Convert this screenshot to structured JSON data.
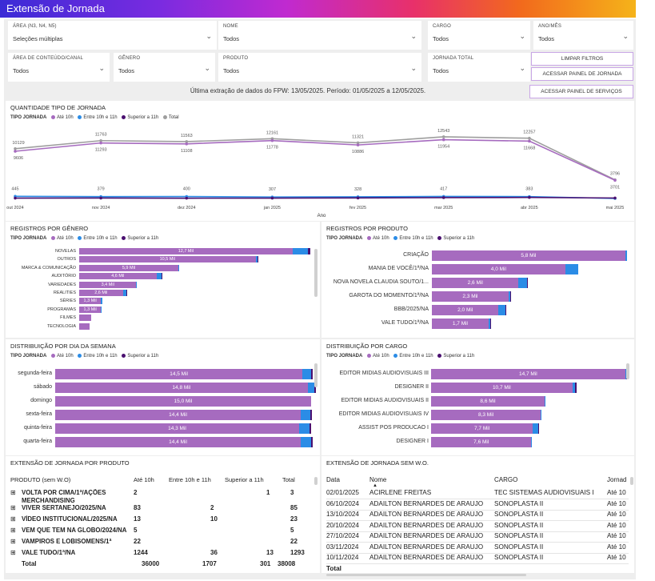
{
  "title": "Extensão de Jornada",
  "filters": [
    {
      "label": "ÁREA (N3, N4, N5)",
      "value": "Seleções múltiplas"
    },
    {
      "label": "NOME",
      "value": "Todos"
    },
    {
      "label": "CARGO",
      "value": "Todos"
    },
    {
      "label": "ANO/MÊS",
      "value": "Todos"
    },
    {
      "label": "ÁREA DE CONTEÚDO/CANAL",
      "value": "Todos"
    },
    {
      "label": "GÊNERO",
      "value": "Todos"
    },
    {
      "label": "PRODUTO",
      "value": "Todos"
    },
    {
      "label": "JORNADA TOTAL",
      "value": "Todos"
    }
  ],
  "buttons": {
    "limpar": "LIMPAR FILTROS",
    "painel_jornada": "ACESSAR PAINEL DE JORNADA",
    "painel_servicos": "ACESSAR PAINEL DE SERVIÇOS"
  },
  "extraction_text": "Última extração de dados do FPW: 13/05/2025. Período: 01/05/2025 a 12/05/2025.",
  "legend_title": "TIPO JORNADA",
  "legend_items": [
    {
      "name": "Até 10h",
      "color": "#a66bbf"
    },
    {
      "name": "Entre 10h e 11h",
      "color": "#2b8ce6"
    },
    {
      "name": "Superior a 11h",
      "color": "#4a1070"
    },
    {
      "name": "Total",
      "color": "#9e9e9e"
    }
  ],
  "chart_data": [
    {
      "type": "line",
      "title": "QUANTIDADE TIPO DE JORNADA",
      "xlabel": "Ano",
      "categories": [
        "out 2024",
        "nov 2024",
        "dez 2024",
        "jan 2025",
        "fev 2025",
        "mar 2025",
        "abr 2025",
        "mai 2025"
      ],
      "series": [
        {
          "name": "Total",
          "values": [
            10129,
            11763,
            11563,
            12161,
            11321,
            12543,
            12257,
            3796
          ],
          "labels": [
            "10129",
            "11763",
            "11563",
            "12161",
            "11321",
            "12543",
            "12257",
            "3796"
          ]
        },
        {
          "name": "Até 10h",
          "values": [
            9606,
            11293,
            11108,
            11778,
            10886,
            11954,
            11668,
            3701
          ],
          "labels": [
            "9606",
            "11293",
            "11108",
            "11778",
            "10886",
            "11954",
            "11668",
            "3701"
          ]
        },
        {
          "name": "Entre 10h e 11h",
          "values": [
            445,
            379,
            400,
            307,
            328,
            417,
            383,
            0
          ],
          "labels": [
            "445",
            "379",
            "400",
            "307",
            "328",
            "417",
            "383",
            ""
          ]
        },
        {
          "name": "Superior a 11h",
          "values": [
            78,
            91,
            55,
            76,
            107,
            172,
            206,
            95
          ],
          "labels": [
            "",
            "",
            "",
            "",
            "",
            "",
            "",
            ""
          ]
        }
      ],
      "ylim": [
        0,
        14000
      ]
    },
    {
      "type": "bar",
      "title": "REGISTROS POR GÊNERO",
      "categories": [
        "NOVELAS",
        "OUTROS",
        "MARCA & COMUNICAÇÃO",
        "AUDITÓRIO",
        "VARIEDADES",
        "REALITIES",
        "SÉRIES",
        "PROGRAMAS",
        "FILMES",
        "TECNOLOGIA"
      ],
      "series": [
        {
          "name": "Até 10h",
          "values": [
            12.7,
            10.5,
            5.9,
            4.6,
            3.4,
            2.6,
            1.3,
            1.3,
            0.7,
            0.6
          ]
        },
        {
          "name": "Entre 10h e 11h",
          "values": [
            0.9,
            0.1,
            0.05,
            0.3,
            0.05,
            0.2,
            0.1,
            0.05,
            0.0,
            0.0
          ]
        },
        {
          "name": "Superior a 11h",
          "values": [
            0.15,
            0.05,
            0.0,
            0.05,
            0.0,
            0.05,
            0.0,
            0.0,
            0.0,
            0.0
          ]
        }
      ],
      "data_labels": [
        "12,7 Mil",
        "10,5 Mil",
        "5,9 Mil",
        "4,6 Mil",
        "3,4 Mil",
        "2,6 Mil",
        "1,3 Mil",
        "1,3 Mil",
        "",
        ""
      ],
      "xlim": [
        0,
        14
      ]
    },
    {
      "type": "bar",
      "title": "REGISTROS POR PRODUTO",
      "categories": [
        "CRIAÇÃO",
        "MANIA DE VOCÊ/1ª/NA",
        "NOVA NOVELA CLAUDIA SOUTO/1...",
        "GAROTA DO MOMENTO/1ª/NA",
        "BBB/2025/NA",
        "VALE TUDO/1ª/NA"
      ],
      "series": [
        {
          "name": "Até 10h",
          "values": [
            5.8,
            4.0,
            2.6,
            2.3,
            2.0,
            1.7
          ]
        },
        {
          "name": "Entre 10h e 11h",
          "values": [
            0.05,
            0.4,
            0.25,
            0.05,
            0.2,
            0.05
          ]
        },
        {
          "name": "Superior a 11h",
          "values": [
            0.0,
            0.0,
            0.02,
            0.01,
            0.02,
            0.01
          ]
        }
      ],
      "data_labels": [
        "5,8 Mil",
        "4,0 Mil",
        "2,6 Mil",
        "2,3 Mil",
        "2,0 Mil",
        "1,7 Mil"
      ],
      "xlim": [
        0,
        5.9
      ]
    },
    {
      "type": "bar",
      "title": "DISTRIBUIÇÃO POR DIA DA SEMANA",
      "categories": [
        "segunda-feira",
        "sábado",
        "domingo",
        "sexta-feira",
        "quinta-feira",
        "quarta-feira"
      ],
      "series": [
        {
          "name": "Até 10h",
          "values": [
            14.5,
            14.8,
            15.0,
            14.4,
            14.3,
            14.4
          ]
        },
        {
          "name": "Entre 10h e 11h",
          "values": [
            0.5,
            0.4,
            0.0,
            0.55,
            0.6,
            0.6
          ]
        },
        {
          "name": "Superior a 11h",
          "values": [
            0.1,
            0.1,
            0.0,
            0.1,
            0.1,
            0.1
          ]
        }
      ],
      "data_labels": [
        "14,5 Mil",
        "14,8 Mil",
        "15,0 Mil",
        "14,4 Mil",
        "14,3 Mil",
        "14,4 Mil"
      ],
      "xlim": [
        0,
        15.1
      ]
    },
    {
      "type": "bar",
      "title": "DISTRIBUIÇÃO POR CARGO",
      "categories": [
        "EDITOR MIDIAS AUDIOVISUAIS III",
        "DESIGNER II",
        "EDITOR MIDIAS AUDIOVISUAIS II",
        "EDITOR MIDIAS AUDIOVISUAIS IV",
        "ASSIST POS PRODUCAO I",
        "DESIGNER I"
      ],
      "series": [
        {
          "name": "Até 10h",
          "values": [
            14.7,
            10.7,
            8.6,
            8.3,
            7.7,
            7.6
          ]
        },
        {
          "name": "Entre 10h e 11h",
          "values": [
            0.1,
            0.2,
            0.05,
            0.05,
            0.4,
            0.05
          ]
        },
        {
          "name": "Superior a 11h",
          "values": [
            0.05,
            0.1,
            0.0,
            0.0,
            0.05,
            0.0
          ]
        }
      ],
      "data_labels": [
        "14,7 Mil",
        "10,7 Mil",
        "8,6 Mil",
        "8,3 Mil",
        "7,7 Mil",
        "7,6 Mil"
      ],
      "xlim": [
        0,
        14.9
      ]
    }
  ],
  "table_produto": {
    "title": "EXTENSÃO DE JORNADA POR PRODUTO",
    "headers": [
      "PRODUTO (sem W.O)",
      "Até 10h",
      "Entre 10h e 11h",
      "Superior a 11h",
      "Total"
    ],
    "rows": [
      {
        "name": "VOLTA POR CIMA/1ª/AÇÕES MERCHANDISING",
        "a": "2",
        "b": "",
        "c": "1",
        "t": "3"
      },
      {
        "name": "VIVER SERTANEJO/2025/NA",
        "a": "83",
        "b": "2",
        "c": "",
        "t": "85"
      },
      {
        "name": "VÍDEO INSTITUCIONAL/2025/NA",
        "a": "13",
        "b": "10",
        "c": "",
        "t": "23"
      },
      {
        "name": "VEM QUE TEM NA GLOBO/2024/NA",
        "a": "5",
        "b": "",
        "c": "",
        "t": "5"
      },
      {
        "name": "VAMPIROS E LOBISOMENS/1ª",
        "a": "22",
        "b": "",
        "c": "",
        "t": "22"
      },
      {
        "name": "VALE TUDO/1ª/NA",
        "a": "1244",
        "b": "36",
        "c": "13",
        "t": "1293"
      }
    ],
    "total": {
      "name": "Total",
      "a": "36000",
      "b": "1707",
      "c": "301",
      "t": "38008"
    }
  },
  "table_sem_wo": {
    "title": "EXTENSÃO DE JORNADA SEM W.O.",
    "headers": [
      "Data",
      "Nome",
      "CARGO",
      "Jornad"
    ],
    "rows": [
      {
        "data": "02/01/2025",
        "nome": "ACIRLENE FREITAS",
        "cargo": "TEC SISTEMAS AUDIOVISUAIS I",
        "j": "Até 10"
      },
      {
        "data": "06/10/2024",
        "nome": "ADAILTON BERNARDES DE ARAUJO",
        "cargo": "SONOPLASTA II",
        "j": "Até 10"
      },
      {
        "data": "13/10/2024",
        "nome": "ADAILTON BERNARDES DE ARAUJO",
        "cargo": "SONOPLASTA II",
        "j": "Até 10"
      },
      {
        "data": "20/10/2024",
        "nome": "ADAILTON BERNARDES DE ARAUJO",
        "cargo": "SONOPLASTA II",
        "j": "Até 10"
      },
      {
        "data": "27/10/2024",
        "nome": "ADAILTON BERNARDES DE ARAUJO",
        "cargo": "SONOPLASTA II",
        "j": "Até 10"
      },
      {
        "data": "03/11/2024",
        "nome": "ADAILTON BERNARDES DE ARAUJO",
        "cargo": "SONOPLASTA II",
        "j": "Até 10"
      },
      {
        "data": "10/11/2024",
        "nome": "ADAILTON BERNARDES DE ARAUJO",
        "cargo": "SONOPLASTA II",
        "j": "Até 10"
      }
    ],
    "total": "Total"
  }
}
